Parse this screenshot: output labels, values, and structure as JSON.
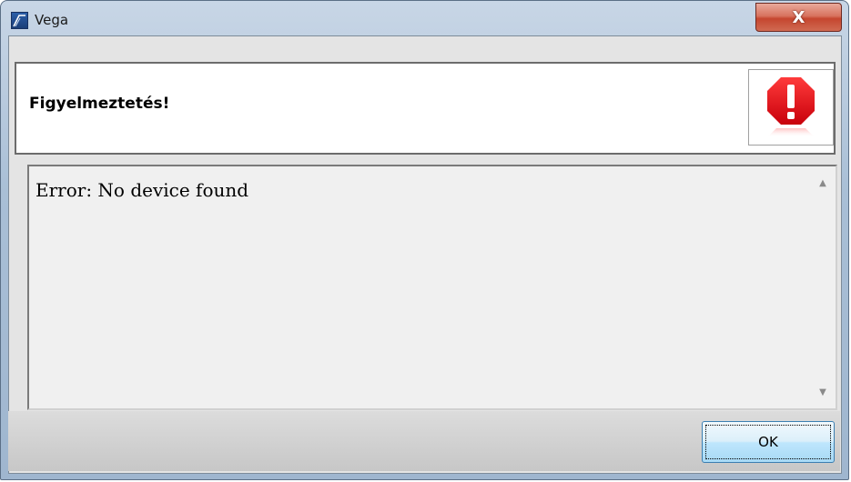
{
  "window": {
    "title": "Vega",
    "close_label": "X"
  },
  "header": {
    "title": "Figyelmeztetés!",
    "icon": "error-stop-icon",
    "icon_color": "#e30613"
  },
  "message": {
    "text": "Error: No device found"
  },
  "buttons": {
    "ok_label": "OK"
  },
  "colors": {
    "titlebar": "#b4c8dd",
    "close_button": "#c5462f",
    "ok_button": "#bee6fd"
  }
}
